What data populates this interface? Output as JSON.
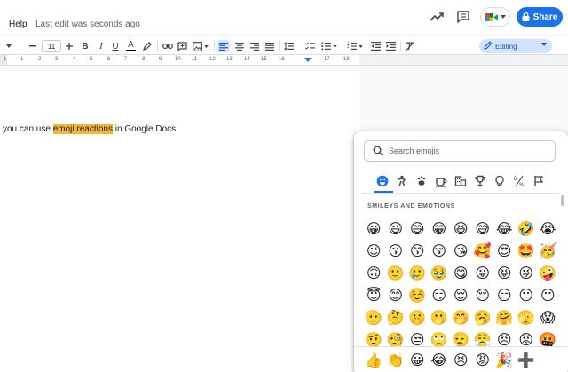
{
  "menu": {
    "help": "Help",
    "last_edit": "Last edit was seconds ago"
  },
  "header": {
    "share_label": "Share"
  },
  "toolbar": {
    "font_size": "11",
    "bold": "B",
    "italic": "I",
    "underline": "U",
    "text_color": "A",
    "editing_label": "Editing"
  },
  "ruler": {
    "ticks": [
      "1",
      "1",
      "2",
      "3",
      "4",
      "5",
      "6",
      "7",
      "8",
      "9",
      "10",
      "11",
      "12",
      "13",
      "14",
      "15",
      "16",
      "17",
      "18"
    ]
  },
  "document": {
    "before": "you can use ",
    "highlight": "emoji reactions",
    "after": " in Google Docs."
  },
  "emoji_picker": {
    "search_placeholder": "Search emojis",
    "categories": [
      "smileys-icon",
      "people-icon",
      "animals-icon",
      "food-icon",
      "travel-icon",
      "activities-icon",
      "objects-icon",
      "symbols-icon",
      "flags-icon"
    ],
    "section_label": "SMILEYS AND EMOTIONS",
    "rows": [
      [
        "😀",
        "😃",
        "😄",
        "😁",
        "😆",
        "😅",
        "😂",
        "🤣",
        "😭"
      ],
      [
        "😉",
        "😗",
        "😙",
        "😚",
        "😘",
        "🥰",
        "😍",
        "🤩",
        "🥳"
      ],
      [
        "🙃",
        "🙂",
        "🥲",
        "🥹",
        "😋",
        "😛",
        "😝",
        "😜",
        "🤪"
      ],
      [
        "😇",
        "😊",
        "☺️",
        "😏",
        "😌",
        "😔",
        "😑",
        "😐",
        "😶"
      ],
      [
        "🫡",
        "🤔",
        "🤫",
        "🫢",
        "🤭",
        "🥱",
        "🤗",
        "🫣",
        "😱"
      ],
      [
        "🤨",
        "🧐",
        "😒",
        "🙄",
        "😮‍💨",
        "😤",
        "😠",
        "😡",
        "🤬"
      ]
    ],
    "frequent": [
      "👍",
      "👏",
      "😀",
      "😂",
      "😣",
      "😡",
      "🎉",
      "➕"
    ]
  },
  "colors": {
    "accent": "#1a73e8",
    "highlight": "#f5b731",
    "editing_bg": "#d3e3fd"
  }
}
